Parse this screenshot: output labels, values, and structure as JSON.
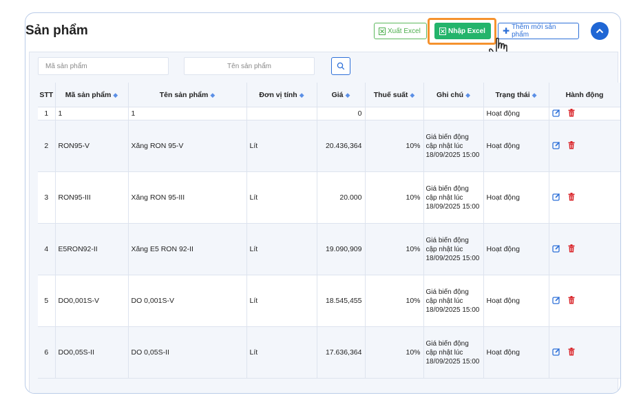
{
  "page": {
    "title": "Sản phẩm"
  },
  "toolbar": {
    "export_label": "Xuất Excel",
    "import_label": "Nhập Excel",
    "add_label": "Thêm mới sản phẩm"
  },
  "filters": {
    "code_placeholder": "Mã sản phẩm",
    "name_placeholder": "Tên sản phẩm"
  },
  "table": {
    "columns": [
      "STT",
      "Mã sản phẩm",
      "Tên sản phẩm",
      "Đơn vị tính",
      "Giá",
      "Thuế suất",
      "Ghi chú",
      "Trạng thái",
      "Hành động"
    ],
    "rows": [
      {
        "stt": "1",
        "code": "1",
        "name": "1",
        "unit": "",
        "price": "0",
        "tax": "",
        "note": "",
        "status": "Hoạt động"
      },
      {
        "stt": "2",
        "code": "RON95-V",
        "name": "Xăng RON 95-V",
        "unit": "Lít",
        "price": "20.436,364",
        "tax": "10%",
        "note": "Giá biến động cập nhật lúc 18/09/2025 15:00",
        "status": "Hoạt động"
      },
      {
        "stt": "3",
        "code": "RON95-III",
        "name": "Xăng RON 95-III",
        "unit": "Lít",
        "price": "20.000",
        "tax": "10%",
        "note": "Giá biến động cập nhật lúc 18/09/2025 15:00",
        "status": "Hoạt động"
      },
      {
        "stt": "4",
        "code": "E5RON92-II",
        "name": "Xăng E5 RON 92-II",
        "unit": "Lít",
        "price": "19.090,909",
        "tax": "10%",
        "note": "Giá biến động cập nhật lúc 18/09/2025 15:00",
        "status": "Hoạt động"
      },
      {
        "stt": "5",
        "code": "DO0,001S-V",
        "name": "DO 0,001S-V",
        "unit": "Lít",
        "price": "18.545,455",
        "tax": "10%",
        "note": "Giá biến động cập nhật lúc 18/09/2025 15:00",
        "status": "Hoạt động"
      },
      {
        "stt": "6",
        "code": "DO0,05S-II",
        "name": "DO 0,05S-II",
        "unit": "Lít",
        "price": "17.636,364",
        "tax": "10%",
        "note": "Giá biến động cập nhật lúc 18/09/2025 15:00",
        "status": "Hoạt động"
      }
    ]
  },
  "icons": {
    "export": "excel-file-icon",
    "import": "excel-file-icon",
    "add": "plus-icon",
    "collapse": "chevron-up-icon",
    "search": "search-icon",
    "sort": "sort-icon",
    "edit": "edit-icon",
    "delete": "trash-icon",
    "cursor": "hand-pointer-icon"
  },
  "colors": {
    "import_button": "#23b46b",
    "export_button": "#4cae4c",
    "add_button": "#2c6fd8",
    "highlight": "#f5922e",
    "edit_icon": "#2c6fd8",
    "delete_icon": "#d9262b"
  }
}
